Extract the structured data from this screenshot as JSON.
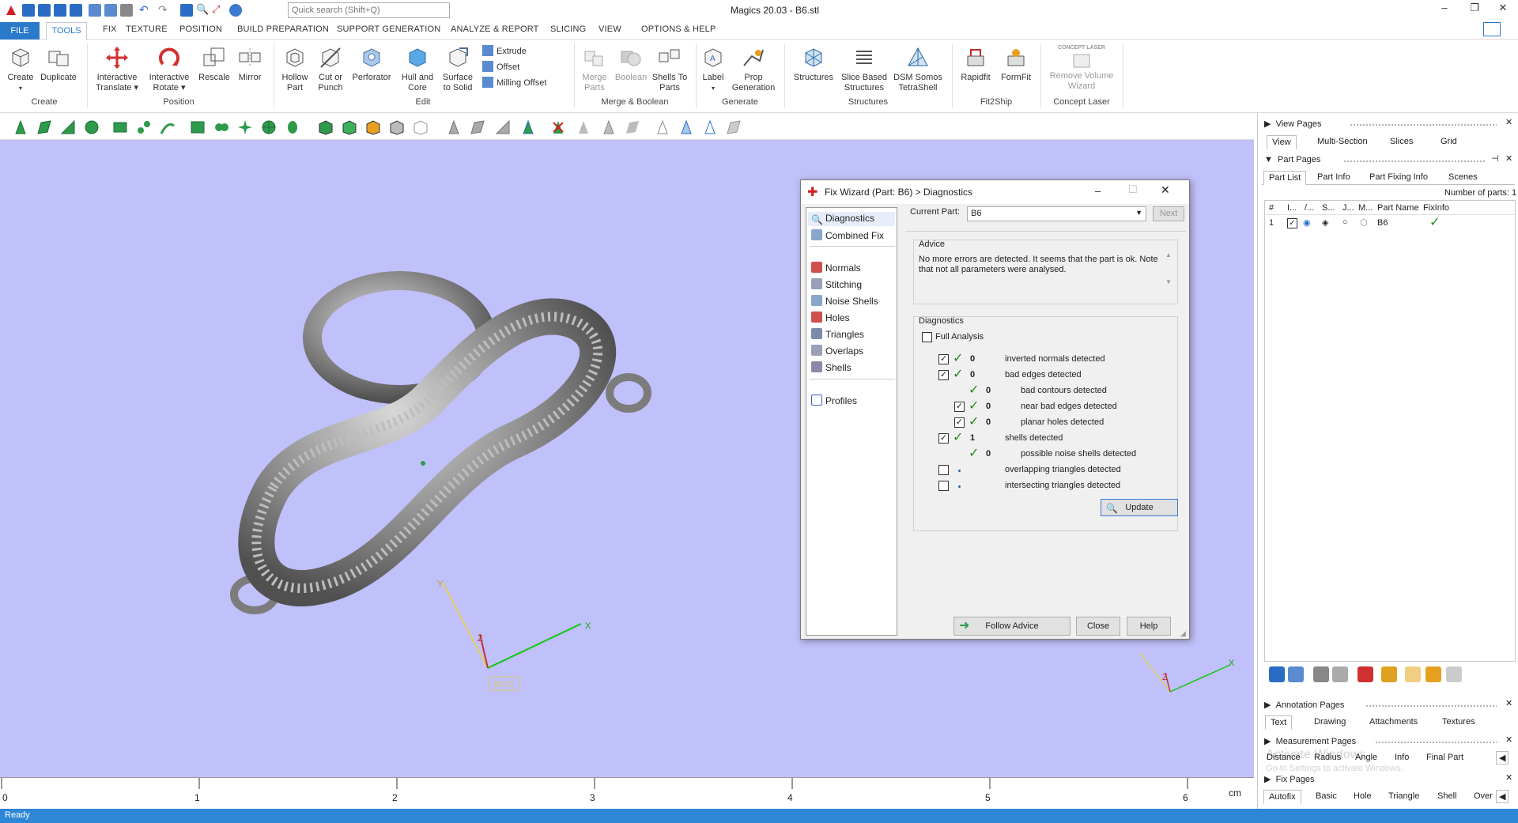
{
  "app": {
    "window_title": "Magics 20.03 - B6.stl",
    "search_placeholder": "Quick search (Shift+Q)",
    "window_controls": [
      "–",
      "❐",
      "✕"
    ]
  },
  "menu": {
    "items": [
      "FILE",
      "TOOLS",
      "FIX",
      "TEXTURE",
      "POSITION",
      "BUILD PREPARATION",
      "SUPPORT GENERATION",
      "ANALYZE & REPORT",
      "SLICING",
      "VIEW",
      "OPTIONS & HELP"
    ],
    "active": "TOOLS"
  },
  "ribbon": {
    "buttons": {
      "create": "Create",
      "duplicate": "Duplicate",
      "interactive_translate": "Interactive Translate",
      "interactive_rotate": "Interactive Rotate",
      "rescale": "Rescale",
      "mirror": "Mirror",
      "hollow_part": "Hollow Part",
      "cut_or_punch": "Cut or Punch",
      "perforator": "Perforator",
      "hull_and_core": "Hull and Core",
      "surface_to_solid": "Surface to Solid",
      "extrude": "Extrude",
      "offset": "Offset",
      "milling_offset": "Milling Offset",
      "merge_parts": "Merge Parts",
      "boolean": "Boolean",
      "shells_to_parts": "Shells To Parts",
      "label": "Label",
      "prop_generation": "Prop Generation",
      "structures": "Structures",
      "slice_based_structures": "Slice Based Structures",
      "dsm_somos_tetrashell": "DSM Somos TetraShell",
      "rapidfit": "Rapidfit",
      "formfit": "FormFit",
      "remove_volume_wizard": "Remove Volume Wizard",
      "concept_laser_logo": "CONCEPT LASER"
    },
    "groups": {
      "create": "Create",
      "position": "Position",
      "edit": "Edit",
      "merge_boolean": "Merge & Boolean",
      "generate": "Generate",
      "structures": "Structures",
      "fit2ship": "Fit2Ship",
      "concept_laser": "Concept Laser"
    }
  },
  "viewport": {
    "background": "#c0c0fa",
    "axis_labels": {
      "x": "X",
      "y": "Y",
      "z": "Z"
    },
    "wcs_label": "WCS",
    "ruler": {
      "ticks": [
        "0",
        "1",
        "2",
        "3",
        "4",
        "5",
        "6"
      ],
      "unit": "cm"
    }
  },
  "status": {
    "text": "Ready"
  },
  "dialog": {
    "title": "Fix Wizard (Part: B6) > Diagnostics",
    "nav": [
      "Diagnostics",
      "Combined Fix",
      "Normals",
      "Stitching",
      "Noise Shells",
      "Holes",
      "Triangles",
      "Overlaps",
      "Shells",
      "Profiles"
    ],
    "current_part_label": "Current Part:",
    "current_part_value": "B6",
    "next_button": "Next",
    "advice_title": "Advice",
    "advice_text": "No more errors are detected. It seems that the part is ok. Note that not all parameters were analysed.",
    "diagnostics_title": "Diagnostics",
    "full_analysis": "Full Analysis",
    "rows": [
      {
        "count": "0",
        "label": "inverted normals detected"
      },
      {
        "count": "0",
        "label": "bad edges detected"
      },
      {
        "count": "0",
        "label": "bad contours detected"
      },
      {
        "count": "0",
        "label": "near bad edges detected"
      },
      {
        "count": "0",
        "label": "planar holes detected"
      },
      {
        "count": "1",
        "label": "shells detected"
      },
      {
        "count": "0",
        "label": "possible noise shells detected"
      },
      {
        "count": "",
        "label": "overlapping triangles detected"
      },
      {
        "count": "",
        "label": "intersecting triangles detected"
      }
    ],
    "update_button": "Update",
    "follow_advice_button": "Follow Advice",
    "close_button": "Close",
    "help_button": "Help"
  },
  "right_panel": {
    "view_pages": "View Pages",
    "view_tabs": [
      "View",
      "Multi-Section",
      "Slices",
      "Grid"
    ],
    "part_pages": "Part Pages",
    "part_tabs": [
      "Part List",
      "Part Info",
      "Part Fixing Info",
      "Scenes"
    ],
    "number_of_parts": "Number of parts: 1",
    "columns": [
      "#",
      "I...",
      "/...",
      "S...",
      "J...",
      "M...",
      "Part Name",
      "FixInfo"
    ],
    "row": {
      "index": "1",
      "name": "B6"
    },
    "annotation_pages": "Annotation Pages",
    "annotation_tabs": [
      "Text",
      "Drawing",
      "Attachments",
      "Textures"
    ],
    "measurement_pages": "Measurement Pages",
    "measurement_tabs": [
      "Distance",
      "Radius",
      "Angle",
      "Info",
      "Final Part"
    ],
    "fix_pages": "Fix Pages",
    "fix_tabs": [
      "Autofix",
      "Basic",
      "Hole",
      "Triangle",
      "Shell",
      "Over"
    ],
    "watermark": "Activate Windows",
    "watermark_sub": "Go to Settings to activate Windows."
  }
}
